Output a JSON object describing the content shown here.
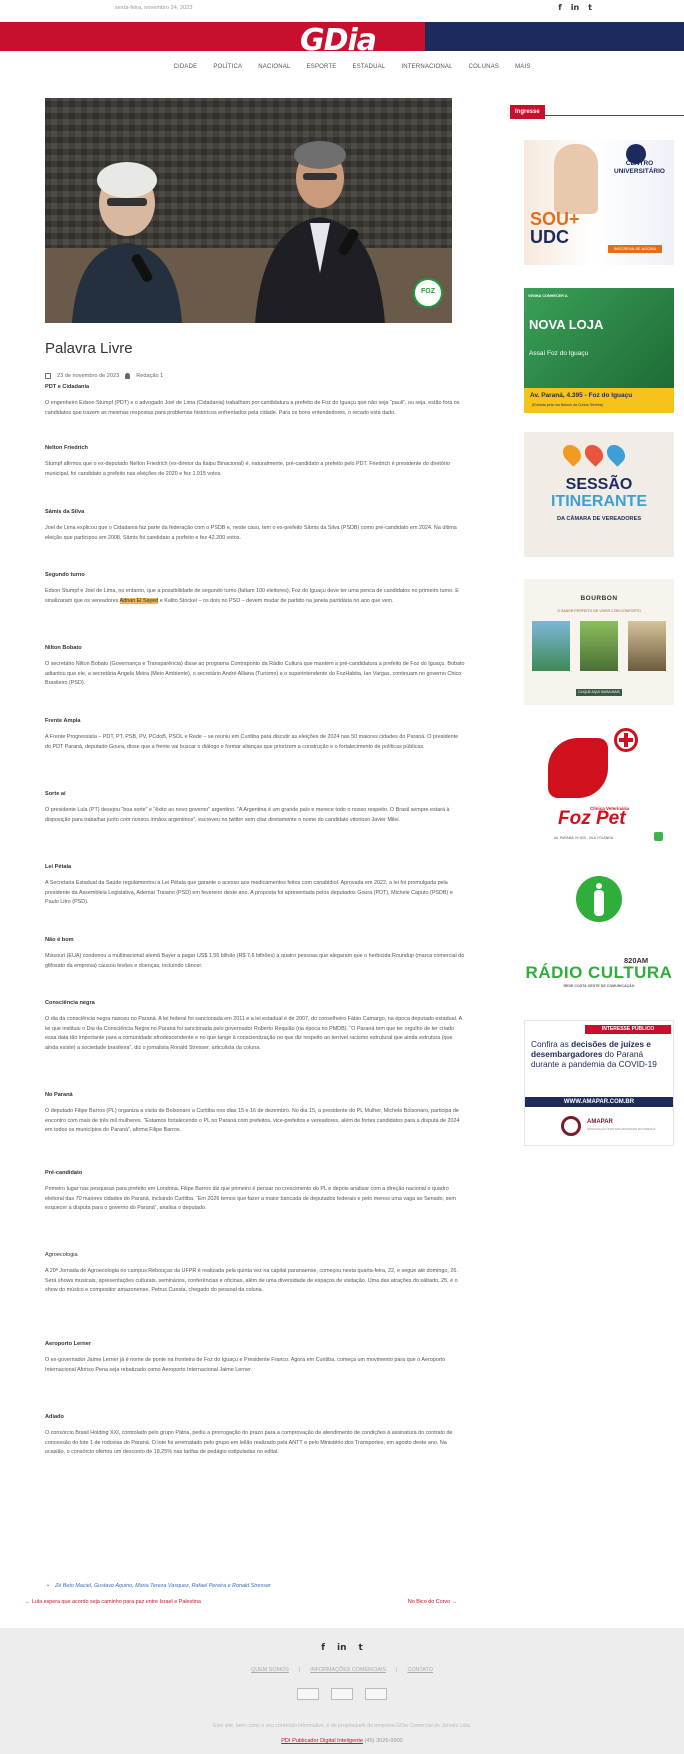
{
  "topbar": {
    "date": "sexta-feira, novembro 24, 2023",
    "social": [
      "f",
      "in",
      "t"
    ]
  },
  "header": {
    "logo_g": "G",
    "logo_dia": "Dia"
  },
  "nav": [
    "CIDADE",
    "POLÍTICA",
    "NACIONAL",
    "ESPORTE",
    "ESTADUAL",
    "INTERNACIONAL",
    "COLUNAS",
    "MAIS"
  ],
  "article": {
    "hero_badge": "FOZ",
    "title": "Palavra Livre",
    "date": "23 de novembro de 2023",
    "author": "Redação 1",
    "sections": [
      {
        "heading": "PDT e Cidadania",
        "text": "O engenheiro Edson Stumpf (PDT) e o advogado Joel de Lima (Cidadania) trabalham por candidatura a prefeito de Foz do Iguaçu que não seja “pauli”, ou seja, estão fora os candidatos que trazem as mesmas respostas para problemas históricos enfrentados pela cidade. Para os bons entendedores, o recado está dado."
      },
      {
        "heading": "Nelton Friedrich",
        "text": "Stumpf afirmou que o ex-deputado Nelton Friedrich (ex-diretor da Itaipu Binacional) é, naturalmente, pré-candidato a prefeito pelo PDT. Friedrich é presidente do diretório municipal, foi candidato a prefeito nas eleições de 2020 e fez 1.915 votos."
      },
      {
        "heading": "Sâmis da Silva",
        "text": "Joel de Lima explicou que o Cidadania faz parte da federação com o PSDB e, neste caso, tem o ex-prefeito Sâmis da Silva (PSDB) como pré-candidato em 2024. Na última eleição que participou em 2008, Sâmis foi candidato a prefeito e fez 42.200 votos."
      },
      {
        "heading": "Segundo turno",
        "text_before": "Edson Stumpf e Joel de Lima, no entanto, que a possibilidade de segundo turno (faltam 100 eleitores), Foz do Iguaçu deve ter uma penca de candidatos no primeiro turno. E sinalizaram que os vereadores ",
        "highlight": "Adnan El Sayed",
        "text_after": " e Kalito Stockel – os dois no PSD – devem mudar de partido na janela partidária no ano que vem."
      },
      {
        "heading": "Nilton Bobato",
        "text": "O secretário Nilton Bobato (Governança e Transparência) disse ao programa Contraponto da Rádio Cultura que mantém a pré-candidatura a prefeito de Foz do Iguaçu. Bobato adiantou que ele, a secretária Angela Meira (Meio Ambiente), o secretário André Alliana (Turismo) e o superintendente do FozHabita, Ian Vargas, continuam no governo Chico Brasileiro (PSD)."
      },
      {
        "heading": "Frente Ampla",
        "text": "A Frente Progressista – PDT, PT, PSB, PV, PCdoB, PSOL e Rede – se reuniu em Curitiba para discutir as eleições de 2024 nas 50 maiores cidades do Paraná. O presidente do PDT Paraná, deputado Goura, disse que a frente vai buscar o diálogo e formar alianças que priorizem a construção e o fortalecimento de políticas públicas."
      },
      {
        "heading": "Sorte aí",
        "text": "O presidente Lula (PT) desejou “boa sorte” e “êxito ao novo governo” argentino. “A Argentina é um grande país e merece todo o nosso respeito. O Brasil sempre estará à disposição para trabalhar junto com nossos irmãos argentinos”, escreveu no twitter sem citar diretamente o nome do candidato vitorioso Javier Milei."
      },
      {
        "heading": "Lei Pétala",
        "text": "A Secretaria Estadual da Saúde regulamentou a Lei Pétala que garante o acesso aos medicamentos feitos com canabidiol. Aprovada em 2022, a lei foi promulgada pela presidente da Assembleia Legislativa, Ademar Traiano (PSD) em fevereiro deste ano. A proposta foi apresentada pelos deputados Goura (PDT), Michele Caputo (PSDB) e Paulo Litro (PSD)."
      },
      {
        "heading": "Não é bom",
        "text": "Missouri (EUA) condenou a multinacional alemã Bayer a pagar US$ 1,56 bilhão (R$ 7,6 bilhões) a quatro pessoas que alegaram que o herbicida Roundup (marca comercial do glifosato da empresa) causou lesões e doenças, incluindo câncer."
      },
      {
        "heading": "Consciência negra",
        "text": "O dia da consciência negra nasceu no Paraná. A lei federal foi sancionada em 2011 e a lei estadual é de 2007, do conselheiro Fábio Camargo, na época deputado estadual. A lei que instituiu o Dia da Consciência Negra no Paraná foi sancionada pelo governador Roberto Requião (na época no PMDB). “O Paraná tem que ter orgulho de ter criado essa data tão importante para a comunidade afrodescendente e no que tange à conscientização no que diz respeito ao terrível racismo estrutural que ainda estrutura (que ainda existe) a sociedade brasileira”, diz o jornalista Ronald Stresser, articulista da coluna."
      },
      {
        "heading": "No Paraná",
        "text": "O deputado Filipe Barros (PL) organiza a visita de Bolsonaro a Curitiba nos dias 15 e 16 de dezembro. No dia 15, a presidente do PL Mulher, Michele Bolsonaro, participa de encontro com mais de três mil mulheres. “Estamos fortalecendo o PL no Paraná com prefeitos, vice-prefeitos e vereadores, além de fortes candidatos para a disputa de 2024 em todos os municípios do Paraná”, afirma Filipe Barros."
      },
      {
        "heading": "Pré-candidato",
        "text": "Primeiro lugar nas pesquisas para prefeito em Londrina, Filipe Barros diz que primeiro é pensar no crescimento do PL e depois analisar com a direção nacional o quadro eleitoral das 70 maiores cidades do Paraná, incluindo Curitiba. “Em 2026 temos que fazer a maior bancada de deputados federais e pelo menos uma vaga ao Senado, sem esquecer a disputa para o governo do Paraná”, analisa o deputado."
      },
      {
        "heading": "Agroecologia",
        "text": "A 20ª Jornada de Agroecologia no campus Rebouças da UFPR é realizada pela quinta vez na capital paranaense, começou nesta quarta-feira, 22, e segue até domingo, 26. Será shows musicais, apresentações culturais, seminários, conferências e oficinas, além de uma diversidade de espaços de visitação. Uma das atrações do sábado, 25, é o show do músico e compositor amazonense, Petrus Cuesta, chegado do pessoal da coluna."
      },
      {
        "heading": "Aeroporto Lerner",
        "text": "O ex-governador Jaime Lerner já é nome de ponte na fronteira de Foz do Iguaçu e Presidente Franco. Agora em Curitiba, começa um movimento para que o Aeroporto Internacional Afonso Pena seja rebatizado como Aeroporto Internacional Jaime Lerner."
      },
      {
        "heading": "Adiado",
        "text": "O consórcio Brasil Holding XXI, controlado pelo grupo Pátria, pediu a prorrogação do prazo para a comprovação de atendimento de condições à assinatura do contrato de concessão do lote 1 de rodovias do Paraná. O lote foi arrematado pelo grupo em leilão realizado pela ANTT e pelo Ministério dos Transportes, em agosto deste ano. Na ocasião, o consórcio ofertou um desconto de 18,25% nas tarifas de pedágio estipuladas no edital."
      }
    ],
    "tags": "Zé Beto Maciel, Gustavo Aquino, Maria Tereza Vasquez, Rafael Pereira e Ronald Stresser",
    "prev": "← Lula espera que acordo seja caminho para paz entre Israel e Palestina",
    "next": "No Bico do Corvo →"
  },
  "sidebar": {
    "heading": "Ingresse",
    "ad1": {
      "sou": "SOU+",
      "udc": "UDC",
      "cu": "CENTRO UNIVERSITÁRIO",
      "btn": "INSCREVA-SE AGORA"
    },
    "ad2": {
      "tag": "VENHA CONHECER A",
      "nova": "NOVA LOJA",
      "sub": "Assaí Foz do Iguaçu",
      "addr": "Av. Paraná, 4.395 - Foz do Iguaçu",
      "small": "(Entrada pela rua Nelson da Cunha Teixeira)"
    },
    "ad3": {
      "s1": "SESSÃO",
      "s2": "ITINERANTE",
      "s3": "DA CÂMARA DE VEREADORES"
    },
    "ad4": {
      "br": "BOURBON",
      "line": "O SABOR PERFEITO DE VIVER COM CONFORTO",
      "btn": "CLIQUE AQUI SAIBA MAIS"
    },
    "ad5": {
      "cv": "Clínica Veterinária",
      "fp": "Foz Pet",
      "addr": "AV. PARANÁ, Nº 833 - VILA YOLANDA"
    },
    "ad6": {
      "am": "820AM",
      "rc": "RÁDIO CULTURA",
      "rc2": "REDE COSTA OESTE DE COMUNICAÇÃO"
    },
    "ad7": {
      "hdr": "INTERESSE PÚBLICO",
      "l1": "Confira as ",
      "l1b": "decisões de juízes e desembargadores",
      "l2": " do Paraná durante a pandemia da COVID-19",
      "url": "WWW.AMAPAR.COM.BR",
      "amp": "AMAPAR",
      "amp2": "ASSOCIAÇÃO DOS MAGISTRADOS DO PARANÁ"
    }
  },
  "footer": {
    "social": [
      "f",
      "in",
      "t"
    ],
    "links": [
      "QUEM SOMOS",
      "INFORMAÇÕES COMERCIAIS",
      "CONTATO"
    ],
    "copy": "Este site, bem como o seu conteúdo informativo, é de propriedade da empresa GDia Comercial de Jornais Ltda.",
    "pub": "PDI Publicador Digital Inteligente",
    "pub_tail": " (45) 3026-9900"
  }
}
